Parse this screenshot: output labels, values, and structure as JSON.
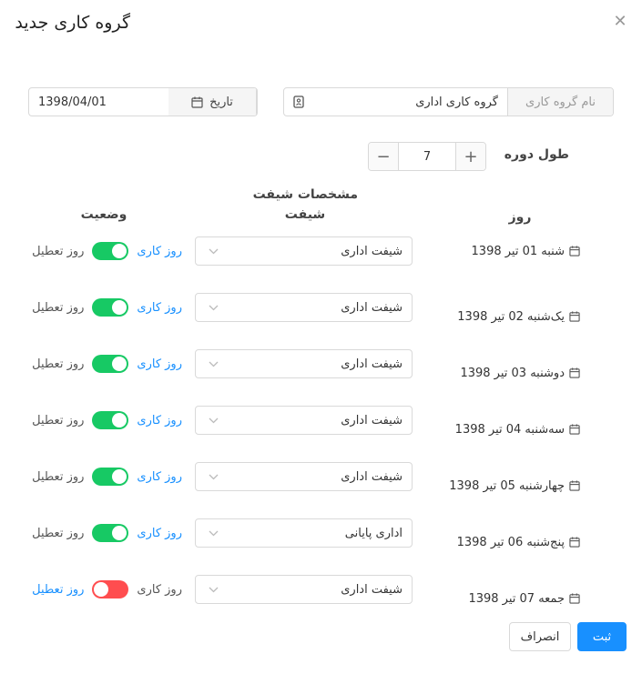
{
  "dialog": {
    "title": "گروه کاری جدید",
    "close_icon": "close-icon"
  },
  "form": {
    "group_name": {
      "label": "نام گروه کاری",
      "value": "گروه کاری اداری",
      "icon": "id-card-icon"
    },
    "date": {
      "label": "تاریخ",
      "value": "1398/04/01",
      "icon": "calendar-icon"
    },
    "period": {
      "label": "طول دوره",
      "value": "7",
      "minus": "−",
      "plus": "+"
    }
  },
  "table": {
    "section_title": "مشخصات شیفت",
    "col_day": "روز",
    "col_shift": "شیفت",
    "col_status": "وضعیت",
    "work_label": "روز کاری",
    "off_label": "روز تعطیل",
    "rows": [
      {
        "date": "شنبه 01 تیر 1398",
        "shift": "شیفت اداری",
        "working": true
      },
      {
        "date": "یک‌شنبه 02 تیر 1398",
        "shift": "شیفت اداری",
        "working": true
      },
      {
        "date": "دوشنبه 03 تیر 1398",
        "shift": "شیفت اداری",
        "working": true
      },
      {
        "date": "سه‌شنبه 04 تیر 1398",
        "shift": "شیفت اداری",
        "working": true
      },
      {
        "date": "چهارشنبه 05 تیر 1398",
        "shift": "شیفت اداری",
        "working": true
      },
      {
        "date": "پنج‌شنبه 06 تیر 1398",
        "shift": "اداری پایانی",
        "working": true
      },
      {
        "date": "جمعه 07 تیر 1398",
        "shift": "شیفت اداری",
        "working": false
      }
    ]
  },
  "footer": {
    "submit_label": "ثبت",
    "cancel_label": "انصراف"
  },
  "colors": {
    "primary": "#1890ff",
    "toggle_on": "#17c964",
    "toggle_off": "#ff4d4f"
  }
}
